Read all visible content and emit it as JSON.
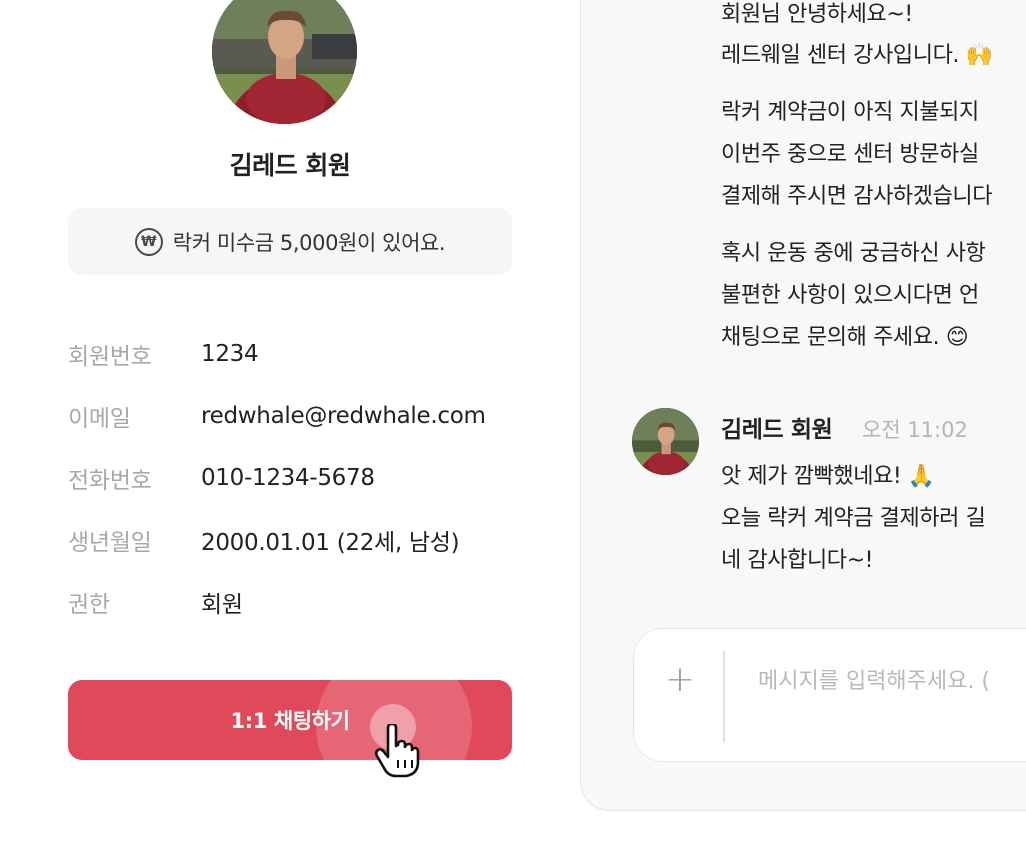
{
  "profile": {
    "name": "김레드 회원",
    "notice": "락커 미수금 5,000원이 있어요.",
    "won_symbol": "₩",
    "fields": [
      {
        "label": "회원번호",
        "value": "1234"
      },
      {
        "label": "이메일",
        "value": "redwhale@redwhale.com"
      },
      {
        "label": "전화번호",
        "value": "010-1234-5678"
      },
      {
        "label": "생년월일",
        "value": "2000.01.01 (22세, 남성)"
      },
      {
        "label": "권한",
        "value": "회원"
      }
    ],
    "chat_button_label": "1:1 채팅하기",
    "accent_color": "#e0495a"
  },
  "chat": {
    "staff_message_lines": [
      "회원님 안녕하세요~!",
      "레드웨일 센터 강사입니다. 🙌",
      "락커 계약금이 아직 지불되지",
      "이번주 중으로 센터 방문하실",
      "결제해 주시면 감사하겠습니다",
      "혹시 운동 중에 궁금하신 사항",
      "불편한 사항이 있으시다면 언",
      "채팅으로 문의해 주세요. 😊"
    ],
    "member_message": {
      "sender": "김레드 회원",
      "time": "오전 11:02",
      "lines": [
        "앗 제가 깜빡했네요! 🙏",
        "오늘 락커 계약금 결제하러 길",
        "네 감사합니다~!"
      ]
    },
    "input": {
      "placeholder": "메시지를 입력해주세요. (",
      "add_symbol": "+"
    }
  }
}
